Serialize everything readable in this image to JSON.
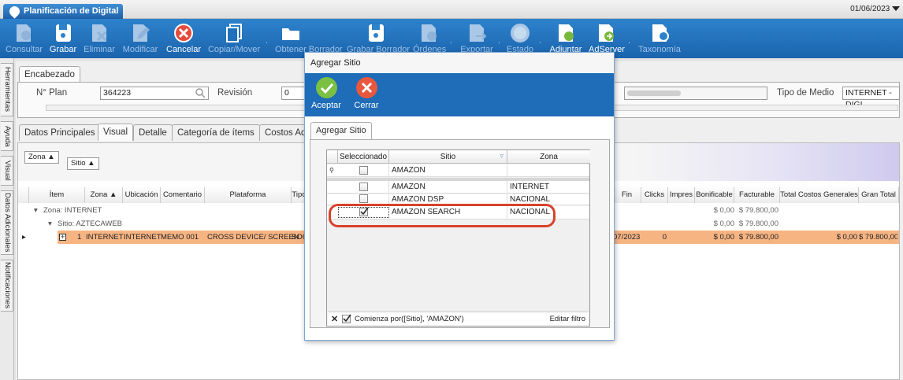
{
  "app": {
    "title": "Planificación de Digital",
    "date": "01/06/2023"
  },
  "toolbar": {
    "consultar": "Consultar",
    "grabar": "Grabar",
    "eliminar": "Eliminar",
    "modificar": "Modificar",
    "cancelar": "Cancelar",
    "copiar": "Copiar/Mover",
    "obtener": "Obtener Borrador",
    "grabar_borrador": "Grabar Borrador",
    "ordenes": "Órdenes",
    "exportar": "Exportar",
    "estado": "Estado",
    "adjuntar": "Adjuntar",
    "adserver": "AdServer",
    "taxonomia": "Taxonomía"
  },
  "side_tabs": [
    "Herramientas",
    "Ayuda",
    "Visual",
    "Datos Adicionales",
    "Notificaciones"
  ],
  "header": {
    "tab": "Encabezado",
    "plan_label": "N° Plan",
    "plan_value": "364223",
    "revision_label": "Revisión",
    "revision_value": "0",
    "tipo_medio_label": "Tipo de Medio",
    "tipo_medio_value": "INTERNET - DIGI"
  },
  "tabs": [
    "Datos Principales",
    "Visual",
    "Detalle",
    "Categoría de ítems",
    "Costos Adi"
  ],
  "group_chips": [
    "Zona",
    "Sitio"
  ],
  "grid": {
    "columns_left": [
      "Ítem",
      "Zona",
      "Ubicación",
      "Comentario",
      "Plataforma",
      "Tipo"
    ],
    "columns_right": [
      "Fin",
      "Clicks",
      "Impres",
      "Bonificable",
      "Facturable",
      "Total Costos Generales",
      "Gran Total"
    ],
    "group1": "Zona: INTERNET",
    "group2": "Sitio: AZTECAWEB",
    "sum_bonificable": "$ 0,00",
    "sum_facturable": "$ 79.800,00",
    "sum2_bonificable": "$ 0,00",
    "sum2_facturable": "$ 79.800,00",
    "row": {
      "item": "1",
      "zona": "INTERNET",
      "ubicacion": "INTERNET",
      "comentario": "MEMO 001",
      "plataforma": "CROSS DEVICE/ SCREEN",
      "tipo": "SOC",
      "fin": "07/2023",
      "clicks": "0",
      "bonificable": "$ 0,00",
      "facturable": "$ 79.800,00",
      "total_costos": "$ 0,00",
      "gran_total": "$ 79.800,00"
    }
  },
  "dialog": {
    "title": "Agregar Sitio",
    "accept": "Aceptar",
    "close": "Cerrar",
    "panel_tab": "Agregar Sitio",
    "columns": [
      "Seleccionado",
      "Sitio",
      "Zona"
    ],
    "filter_value": "AMAZON",
    "rows": [
      {
        "sitio": "AMAZON",
        "zona": "INTERNET",
        "selected": false
      },
      {
        "sitio": "AMAZON DSP",
        "zona": "NACIONAL",
        "selected": false
      },
      {
        "sitio": "AMAZON SEARCH",
        "zona": "NACIONAL",
        "selected": true
      }
    ],
    "filter_text": "Comienza por([Sitio], 'AMAZON')",
    "edit_filter": "Editar filtro"
  },
  "colors": {
    "toolbar": "#1f6cb8",
    "selected_row": "#f6b483",
    "highlight": "#d9412c"
  }
}
